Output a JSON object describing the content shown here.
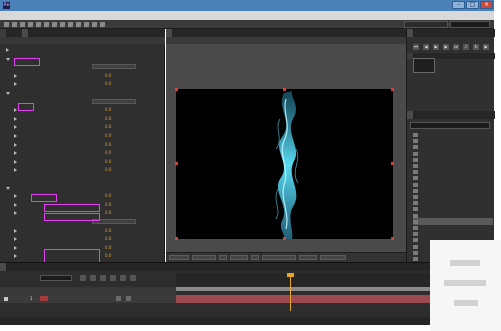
{
  "window": {
    "title": "",
    "app_icon_text": "Ae",
    "minimize": "–",
    "maximize": "□",
    "close": "×"
  },
  "menu": [
    "",
    "",
    "",
    "",
    "",
    "",
    "",
    "",
    ""
  ],
  "toolbar": {
    "workspace": "",
    "search_placeholder": ""
  },
  "left_panel": {
    "tab_project": "",
    "tab_effects": "",
    "breadcrumb": "",
    "rows": [
      {
        "label": "",
        "indent": 0,
        "twirl": "closed"
      },
      {
        "label": "",
        "indent": 0,
        "twirl": "open"
      },
      {
        "label": "",
        "indent": 1,
        "twirl": "none",
        "dropdown": ""
      },
      {
        "label": "",
        "indent": 1,
        "twirl": "closed",
        "value": "0.0"
      },
      {
        "label": "",
        "indent": 1,
        "twirl": "closed",
        "value": "0.0"
      },
      {
        "label": "",
        "indent": 0,
        "twirl": "open"
      },
      {
        "label": "",
        "indent": 1,
        "twirl": "none",
        "dropdown": ""
      },
      {
        "label": "",
        "indent": 1,
        "twirl": "closed",
        "value": "0.0"
      },
      {
        "label": "",
        "indent": 1,
        "twirl": "closed",
        "value": "0.0"
      },
      {
        "label": "",
        "indent": 1,
        "twirl": "closed",
        "value": "0.0"
      },
      {
        "label": "",
        "indent": 1,
        "twirl": "closed",
        "value": "0.0"
      },
      {
        "label": "",
        "indent": 1,
        "twirl": "closed",
        "value": "0.0"
      },
      {
        "label": "",
        "indent": 1,
        "twirl": "closed",
        "value": "0.0"
      },
      {
        "label": "",
        "indent": 1,
        "twirl": "closed",
        "value": "0.0"
      },
      {
        "label": "",
        "indent": 1,
        "twirl": "closed",
        "value": "0.0"
      },
      {
        "label": "",
        "indent": 1,
        "twirl": "none",
        "value": ""
      },
      {
        "label": "",
        "indent": 0,
        "twirl": "open"
      },
      {
        "label": "",
        "indent": 1,
        "twirl": "closed",
        "value": "0.0"
      },
      {
        "label": "",
        "indent": 1,
        "twirl": "closed",
        "value": "0.0"
      },
      {
        "label": "",
        "indent": 1,
        "twirl": "closed",
        "value": "0.0"
      },
      {
        "label": "",
        "indent": 1,
        "twirl": "none",
        "dropdown": ""
      },
      {
        "label": "",
        "indent": 1,
        "twirl": "closed",
        "value": "0.0"
      },
      {
        "label": "",
        "indent": 1,
        "twirl": "closed",
        "value": "0.0"
      },
      {
        "label": "",
        "indent": 1,
        "twirl": "closed",
        "value": "0.0"
      },
      {
        "label": "",
        "indent": 1,
        "twirl": "closed",
        "value": "0.0"
      }
    ]
  },
  "viewer": {
    "tab_comp": "",
    "breadcrumb": "",
    "controls": [
      "",
      "",
      "",
      "",
      "",
      "",
      "",
      ""
    ]
  },
  "right_panel": {
    "preview_tab": "",
    "info_tab": "",
    "info_lines": [
      "",
      "",
      "",
      ""
    ],
    "effects_tab": "",
    "effects_list": [
      "",
      "",
      "",
      "",
      "",
      "",
      "",
      "",
      "",
      "",
      "",
      "",
      "",
      "",
      "",
      "",
      "",
      "",
      "",
      "",
      ""
    ],
    "selected_effect_index": 14
  },
  "timeline": {
    "tab_label": "",
    "time": "",
    "fps": "",
    "columns": [
      "",
      "",
      ""
    ],
    "layer": {
      "index": "1",
      "name": ""
    },
    "ticks": [
      "",
      "",
      "",
      "",
      "",
      "",
      "",
      "",
      "",
      ""
    ],
    "footer": ""
  },
  "colors": {
    "accent": "#e8a628",
    "highlight": "#e43cf0",
    "selection": "#5a5a5a",
    "title_bar": "#4a81b8",
    "layer_bar": "#9b4a52"
  }
}
